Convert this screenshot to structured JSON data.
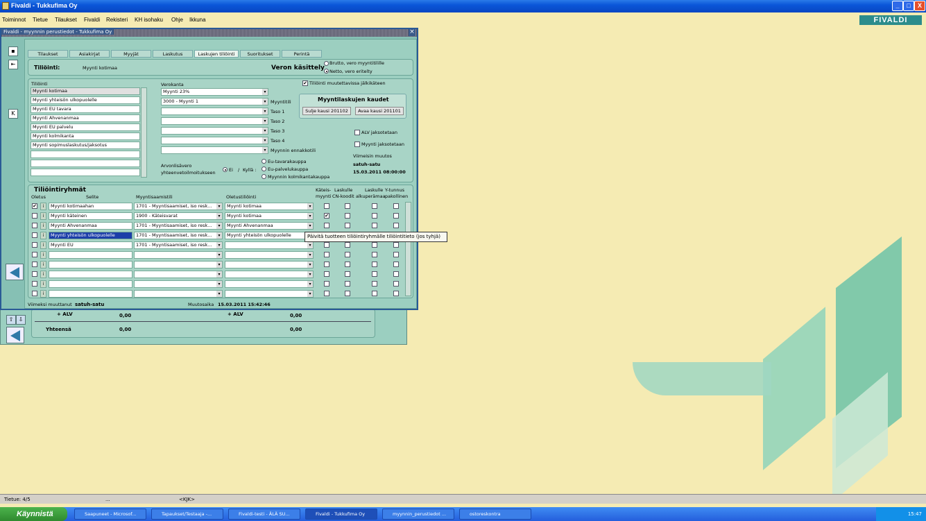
{
  "app": {
    "title": "Fivaldi - Tukkufima Oy",
    "logo": "FIVALDI"
  },
  "window_controls": {
    "minimize": "_",
    "maximize": "□",
    "close": "X"
  },
  "menu": [
    "Toiminnot",
    "Tietue",
    "Tilaukset",
    "Fivaldi",
    "Rekisteri",
    "KH isohaku",
    "Ohje",
    "Ikkuna"
  ],
  "dialog": {
    "title": "Fivaldi - myynnin perustiedot - Tukkufima Oy",
    "close": "×",
    "tabs": [
      "Tilaukset",
      "Asiakirjat",
      "Myyjät",
      "Laskutus",
      "Laskujen tiliöinti",
      "Suoritukset",
      "Perintä"
    ],
    "active_tab": "Laskujen tiliöinti",
    "header": {
      "tiliointi_label": "Tiliöinti:",
      "tiliointi_value": "Myynti kotimaa",
      "veron_label": "Veron käsittely",
      "veron_options": [
        "Brutto, vero myyntitilille",
        "Netto, vero eritelty"
      ],
      "veron_selected": 1,
      "muutettavissa_label": "Tiliöinti muutettavissa jälkikäteen",
      "muutettavissa_checked": "✔"
    },
    "tiliointi_list": {
      "label": "Tiliöinti",
      "items": [
        "Myynti kotimaa",
        "Myynti yhteisön ulkopuolelle",
        "Myynti EU tavara",
        "Myynti Ahvenanmaa",
        "Myynti EU palvelu",
        "Myynti kolmikanta",
        "Myynti sopimuslaskutus/jaksotus",
        "",
        "",
        "",
        ""
      ]
    },
    "verokanta_label": "Verokanta",
    "verokanta_value": "Myynti 23%",
    "account_fields": [
      {
        "value": "3000 - Myynti 1",
        "label": "Myyntitili"
      },
      {
        "value": "",
        "label": "Taso 1"
      },
      {
        "value": "",
        "label": "Taso 2"
      },
      {
        "value": "",
        "label": "Taso 3"
      },
      {
        "value": "",
        "label": "Taso 4"
      },
      {
        "value": "",
        "label": "Myynnin ennakkotili"
      }
    ],
    "kaudet": {
      "title": "Myyntilaskujen kaudet",
      "close_btn": "Sulje kausi 201102",
      "open_btn": "Avaa kausi 201101"
    },
    "alv_jaksotetaan": "ALV jaksotetaan",
    "myynti_jaksotetaan": "Myynti jaksotetaan",
    "viimeisin": {
      "label": "Viimeisin muutos",
      "user": "satuh-satu",
      "time": "15.03.2011 08:00:00"
    },
    "arvonlisavero": {
      "label1": "Arvonlisävero",
      "label2": "yhteenvetoilmoitukseen",
      "ei": "Ei",
      "sep": "/",
      "kylla": "Kyllä :",
      "options": [
        "Eu-tavarakauppa",
        "Eu-palvelukauppa",
        "Myynnin kolmikantakauppa"
      ]
    },
    "groups": {
      "title": "Tiliöintiryhmät",
      "headers": {
        "oletus": "Oletus",
        "selite": "Selite",
        "myyntisaamistili": "Myyntisaamistili",
        "oletustiliointi": "Oletustiliöinti",
        "kateis1": "Käteis-",
        "kateis2": "myynti",
        "laskulle1": "Laskulle",
        "laskulle2": "CN-koodit",
        "laskulle3": "Laskulle",
        "laskulle4": "alkuperämaa",
        "ytunnus1": "Y-tunnus",
        "ytunnus2": "pakollinen"
      },
      "info_btn": "i",
      "rows": [
        {
          "oletus": "✔",
          "selite": "Myynti kotimaahan",
          "saamistili": "1701 - Myyntisaamiset, iso resk...",
          "oletus_tili": "Myynti kotimaa",
          "kateis": ""
        },
        {
          "oletus": "",
          "selite": "Myynti käteinen",
          "saamistili": "1900 - Käteisvarat",
          "oletus_tili": "Myynti kotimaa",
          "kateis": "✔"
        },
        {
          "oletus": "",
          "selite": "Myynti Ahvenanmaa",
          "saamistili": "1701 - Myyntisaamiset, iso resk...",
          "oletus_tili": "Myynti Ahvenanmaa",
          "kateis": ""
        },
        {
          "oletus": "",
          "selite": "Myynti yhteisön ulkopuolelle",
          "saamistili": "1701 - Myyntisaamiset, iso resk...",
          "oletus_tili": "Myynti yhteisön ulkopuolelle",
          "kateis": ""
        },
        {
          "oletus": "",
          "selite": "Myynti EU",
          "saamistili": "1701 - Myyntisaamiset, iso resk...",
          "oletus_tili": "",
          "kateis": ""
        },
        {
          "oletus": "",
          "selite": "",
          "saamistili": "",
          "oletus_tili": "",
          "kateis": ""
        },
        {
          "oletus": "",
          "selite": "",
          "saamistili": "",
          "oletus_tili": "",
          "kateis": ""
        },
        {
          "oletus": "",
          "selite": "",
          "saamistili": "",
          "oletus_tili": "",
          "kateis": ""
        },
        {
          "oletus": "",
          "selite": "",
          "saamistili": "",
          "oletus_tili": "",
          "kateis": ""
        },
        {
          "oletus": "",
          "selite": "",
          "saamistili": "",
          "oletus_tili": "",
          "kateis": ""
        }
      ]
    },
    "footer": {
      "muuttanut_label": "Viimeksi muuttanut",
      "muuttanut_value": "satuh-satu",
      "aika_label": "Muutosaika",
      "aika_value": "15.03.2011 15:42:46"
    },
    "tooltip": "Päivitä tuotteen tiliöintiryhmälle tiliöintitieto (jos tyhjä)"
  },
  "background_window": {
    "alv1_label": "+ ALV",
    "alv1_value": "0,00",
    "alv2_label": "+ ALV",
    "alv2_value": "0,00",
    "total_label": "Yhteensä",
    "total1": "0,00",
    "total2": "0,00"
  },
  "statusbar": {
    "record": "Tietue: 4/5",
    "dots": "...",
    "kjk": "<KJK>"
  },
  "taskbar": {
    "start": "Käynnistä",
    "tasks": [
      "Saapuneet - Microsof...",
      "Tapaukset/Testaaja -...",
      "Fivaldi-testi - ÄLÄ SU...",
      "Fivaldi - Tukkufima Oy",
      "myynnin_perustiedot ...",
      "ostoreskontra"
    ],
    "active_task": 3,
    "lang": "FI",
    "clock": "15:47"
  }
}
